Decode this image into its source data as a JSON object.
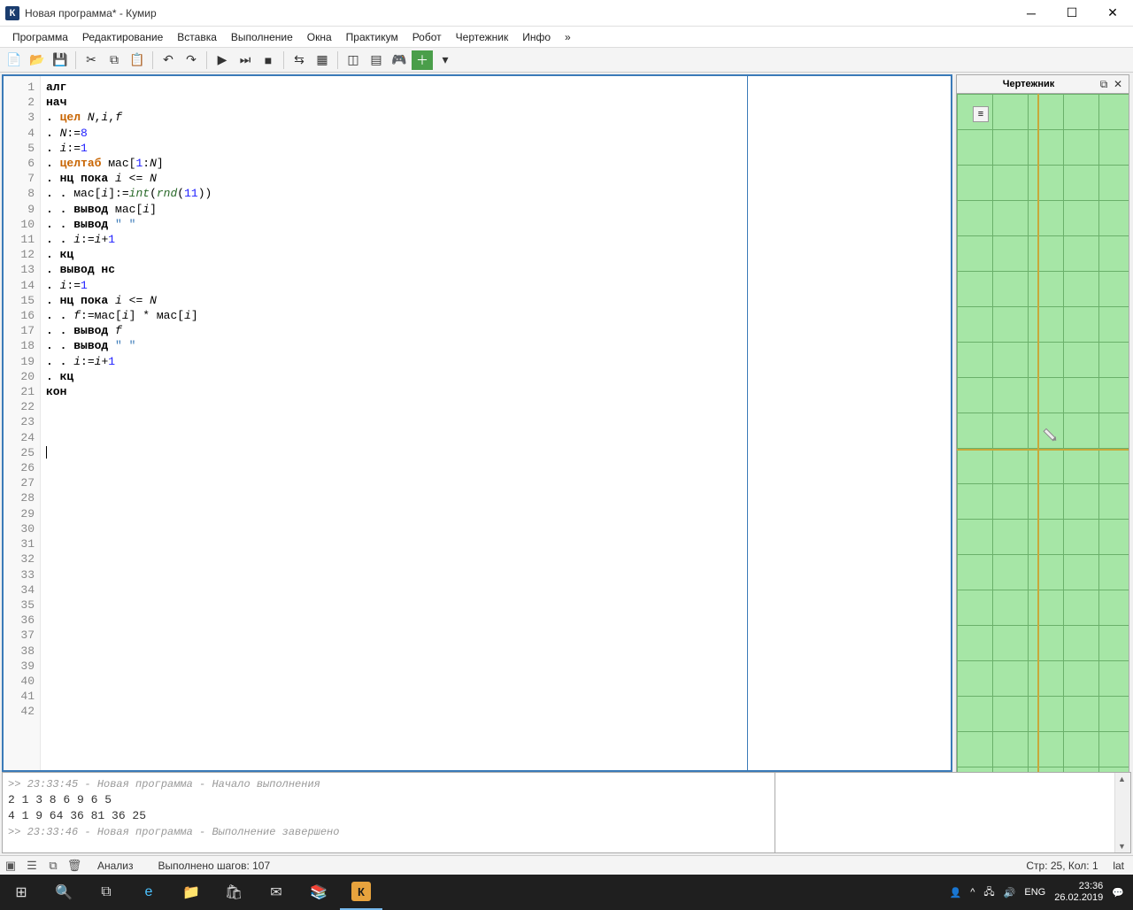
{
  "window": {
    "title": "Новая программа* - Кумир",
    "app_icon_letter": "К"
  },
  "menu": [
    "Программа",
    "Редактирование",
    "Вставка",
    "Выполнение",
    "Окна",
    "Практикум",
    "Робот",
    "Чертежник",
    "Инфо",
    "»"
  ],
  "code_lines": 42,
  "code": [
    {
      "n": 1,
      "html": "<span class='kw'>алг</span>"
    },
    {
      "n": 2,
      "html": "<span class='kw'>нач</span>"
    },
    {
      "n": 3,
      "html": "<span class='dot'>. </span><span class='kw-or'>цел</span> <span class='it'>N</span>,<span class='it'>i</span>,<span class='it'>f</span>"
    },
    {
      "n": 4,
      "html": "<span class='dot'>. </span><span class='it'>N</span>:=<span class='num'>8</span>"
    },
    {
      "n": 5,
      "html": "<span class='dot'>. </span><span class='it'>i</span>:=<span class='num'>1</span>"
    },
    {
      "n": 6,
      "html": "<span class='dot'>. </span><span class='kw-or'>целтаб</span> мас[<span class='num'>1</span>:<span class='it'>N</span>]"
    },
    {
      "n": 7,
      "html": "<span class='dot'>. </span><span class='kw'>нц пока</span> <span class='it'>i</span> &lt;= <span class='it'>N</span>"
    },
    {
      "n": 8,
      "html": "<span class='dot'>. . </span>мас[<span class='it'>i</span>]:=<span class='fn'>int</span>(<span class='fn'>rnd</span>(<span class='num'>11</span>))"
    },
    {
      "n": 9,
      "html": "<span class='dot'>. . </span><span class='kw'>вывод</span> мас[<span class='it'>i</span>]"
    },
    {
      "n": 10,
      "html": "<span class='dot'>. . </span><span class='kw'>вывод</span> <span class='str'>\" \"</span>"
    },
    {
      "n": 11,
      "html": "<span class='dot'>. . </span><span class='it'>i</span>:=<span class='it'>i</span>+<span class='num'>1</span>"
    },
    {
      "n": 12,
      "html": "<span class='dot'>. </span><span class='kw'>кц</span>"
    },
    {
      "n": 13,
      "html": "<span class='dot'>. </span><span class='kw'>вывод нс</span>"
    },
    {
      "n": 14,
      "html": "<span class='dot'>. </span><span class='it'>i</span>:=<span class='num'>1</span>"
    },
    {
      "n": 15,
      "html": "<span class='dot'>. </span><span class='kw'>нц пока</span> <span class='it'>i</span> &lt;= <span class='it'>N</span>"
    },
    {
      "n": 16,
      "html": "<span class='dot'>. . </span><span class='it'>f</span>:=мас[<span class='it'>i</span>] * мас[<span class='it'>i</span>]"
    },
    {
      "n": 17,
      "html": "<span class='dot'>. . </span><span class='kw'>вывод</span> <span class='it'>f</span>"
    },
    {
      "n": 18,
      "html": "<span class='dot'>. . </span><span class='kw'>вывод</span> <span class='str'>\" \"</span>"
    },
    {
      "n": 19,
      "html": "<span class='dot'>. . </span><span class='it'>i</span>:=<span class='it'>i</span>+<span class='num'>1</span>"
    },
    {
      "n": 20,
      "html": "<span class='dot'>. </span><span class='kw'>кц</span>"
    },
    {
      "n": 21,
      "html": "<span class='kw'>кон</span>"
    },
    {
      "n": 22,
      "html": ""
    },
    {
      "n": 23,
      "html": ""
    },
    {
      "n": 24,
      "html": ""
    },
    {
      "n": 25,
      "html": "<span class='cursor'></span>"
    }
  ],
  "right_panel": {
    "title": "Чертежник"
  },
  "console": {
    "meta1": ">> 23:33:45 - Новая программа - Начало выполнения",
    "line1": "2 1 3 8 6 9 6 5 ",
    "line2": "4 1 9 64 36 81 36 25 ",
    "meta2": ">> 23:33:46 - Новая программа - Выполнение завершено"
  },
  "status": {
    "analysis": "Анализ",
    "steps": "Выполнено шагов: 107",
    "pos": "Стр: 25, Кол: 1",
    "mode": "lat"
  },
  "tray": {
    "lang": "ENG",
    "time": "23:36",
    "date": "26.02.2019"
  }
}
